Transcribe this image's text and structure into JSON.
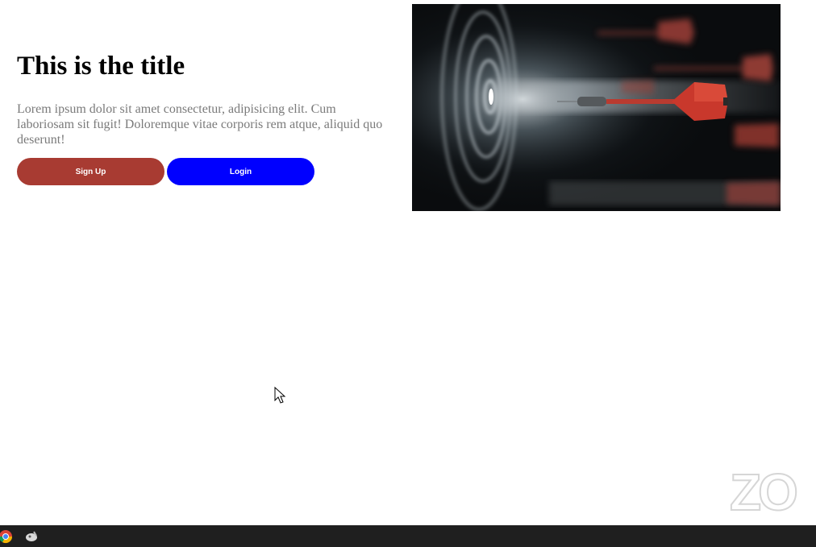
{
  "hero": {
    "title": "This is the title",
    "description": "Lorem ipsum dolor sit amet consectetur, adipisicing elit. Cum laboriosam sit fugit! Doloremque vitae corporis rem atque, aliquid quo deserunt!"
  },
  "buttons": {
    "signup_label": "Sign Up",
    "login_label": "Login"
  },
  "colors": {
    "signup": "#a83b32",
    "login": "#0000ff"
  },
  "image": {
    "icon": "dart-target-image"
  },
  "watermark": {
    "text": "ZO"
  },
  "taskbar": {
    "icons": [
      "chrome-icon",
      "app-icon"
    ]
  }
}
